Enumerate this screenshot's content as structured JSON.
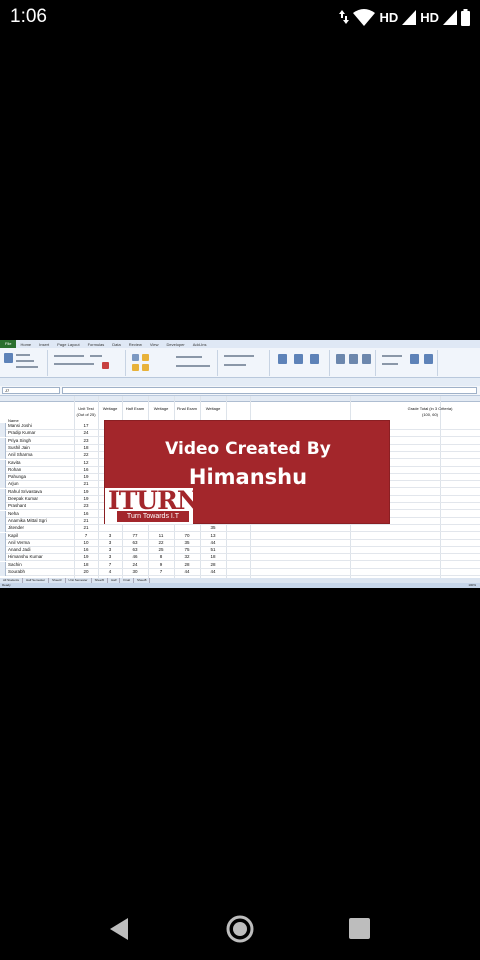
{
  "status_bar": {
    "time": "1:06",
    "network_1": "HD",
    "network_2": "HD",
    "icons": [
      "data-arrows-icon",
      "wifi-icon",
      "signal-icon",
      "signal-icon",
      "battery-icon"
    ]
  },
  "video": {
    "overlay": {
      "line1": "Video Created By",
      "line2": "Himanshu",
      "logo_text": "TURN",
      "logo_prefix": "I",
      "logo_tagline": "Turn Towards I.T",
      "colors": {
        "brand_red": "#a3262b",
        "white": "#ffffff"
      }
    },
    "excel": {
      "ribbon_tabs": [
        "File",
        "Home",
        "Insert",
        "Page Layout",
        "Formulas",
        "Data",
        "Review",
        "View",
        "Developer",
        "Add-Ins"
      ],
      "name_box": "J7",
      "formula": "",
      "headers": {
        "name": "Name",
        "c1": "Unit Test",
        "c1b": "(Out of 25)",
        "c2": "Weitage",
        "c3": "Half Exam",
        "c4": "Weitage",
        "c5": "Final Exam",
        "c6": "Weitage",
        "right_note": "Grade Total (in 3 Criteria)",
        "right_note2": "(100, 60)"
      },
      "rows": [
        {
          "name": "Mansi Joshi",
          "v": [
            "17",
            "",
            "",
            "",
            "",
            ""
          ]
        },
        {
          "name": "Pradip Kumar",
          "v": [
            "24",
            "",
            "",
            "",
            "",
            ""
          ]
        },
        {
          "name": "Priya Singh",
          "v": [
            "23",
            "",
            "",
            "",
            "",
            ""
          ]
        },
        {
          "name": "Sushil Jain",
          "v": [
            "18",
            "",
            "",
            "",
            "",
            ""
          ]
        },
        {
          "name": "Anil Sharma",
          "v": [
            "22",
            "",
            "",
            "",
            "",
            ""
          ]
        },
        {
          "name": "Kavita",
          "v": [
            "12",
            "",
            "",
            "",
            "",
            ""
          ]
        },
        {
          "name": "Rohan",
          "v": [
            "16",
            "",
            "",
            "",
            "",
            ""
          ]
        },
        {
          "name": "Pahunga",
          "v": [
            "19",
            "",
            "",
            "",
            "",
            ""
          ]
        },
        {
          "name": "Arjun",
          "v": [
            "21",
            "",
            "",
            "",
            "",
            ""
          ]
        },
        {
          "name": "Rahul Srivastava",
          "v": [
            "19",
            "",
            "",
            "",
            "",
            ""
          ]
        },
        {
          "name": "Deepak Kumar",
          "v": [
            "19",
            "",
            "",
            "",
            "",
            ""
          ]
        },
        {
          "name": "Prashant",
          "v": [
            "23",
            "",
            "",
            "",
            "",
            ""
          ]
        },
        {
          "name": "Neha",
          "v": [
            "16",
            "",
            "",
            "",
            "",
            ""
          ]
        },
        {
          "name": "Anamika Mittal Sgri",
          "v": [
            "21",
            "",
            "",
            "",
            "",
            ""
          ]
        },
        {
          "name": "Jitender",
          "v": [
            "21",
            "",
            "",
            "",
            "",
            "35"
          ]
        },
        {
          "name": "Kapil",
          "v": [
            "7",
            "3",
            "77",
            "11",
            "70",
            "13"
          ]
        },
        {
          "name": "Anil Verma",
          "v": [
            "10",
            "3",
            "63",
            "22",
            "35",
            "44"
          ]
        },
        {
          "name": "Anand Jadi",
          "v": [
            "16",
            "3",
            "63",
            "25",
            "75",
            "51"
          ]
        },
        {
          "name": "Himanshu Kumar",
          "v": [
            "19",
            "3",
            "46",
            "8",
            "32",
            "18"
          ]
        },
        {
          "name": "Sachin",
          "v": [
            "18",
            "7",
            "24",
            "9",
            "28",
            "28"
          ]
        },
        {
          "name": "Sourabh",
          "v": [
            "20",
            "4",
            "30",
            "7",
            "44",
            "44"
          ]
        }
      ],
      "sheet_tabs": [
        "All Students",
        "Half Semester",
        "Sheet3",
        "Unit Semester",
        "Sheet5",
        "Half",
        "Final",
        "Sheet8"
      ],
      "status": "Ready",
      "zoom": "100%"
    }
  },
  "nav_bar": {
    "icons": [
      "back-triangle-icon",
      "home-circle-icon",
      "recents-square-icon"
    ]
  }
}
